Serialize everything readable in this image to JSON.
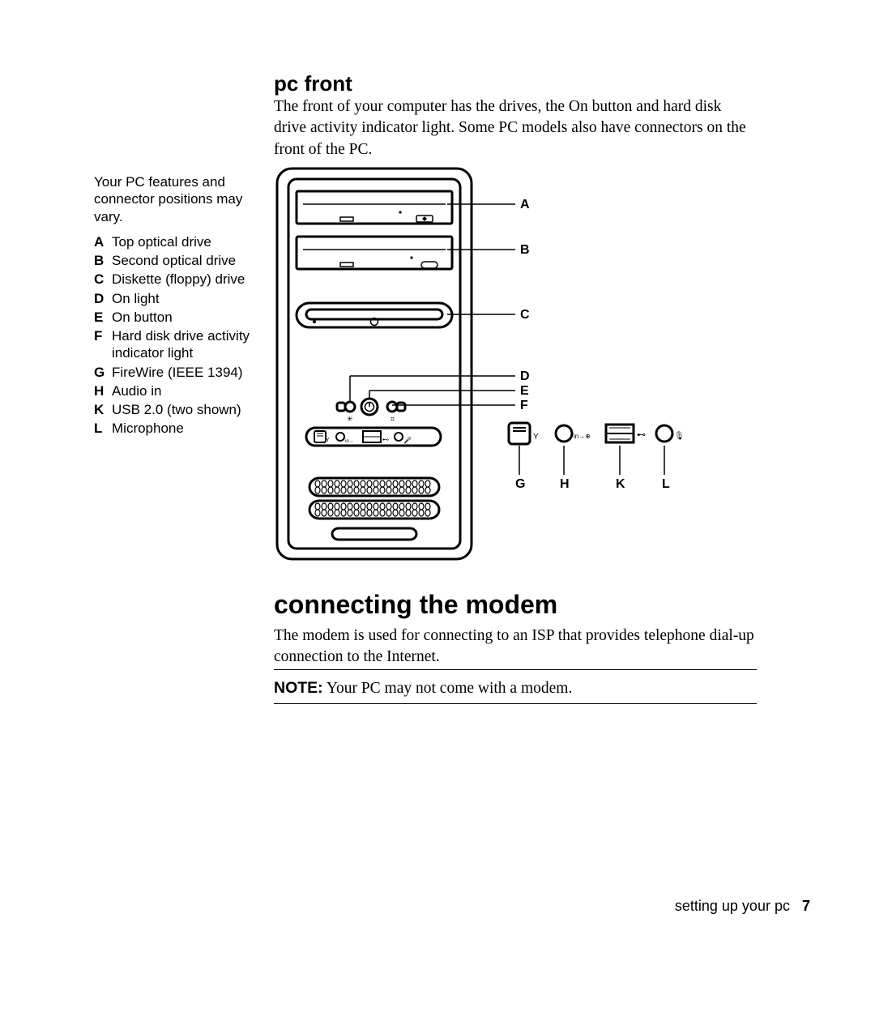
{
  "section1": {
    "title": "pc front",
    "body": "The front of your computer has the drives, the On button and hard disk drive activity indicator light. Some PC models also have connectors on the front of the PC."
  },
  "sidebar": {
    "intro": "Your PC features and connector positions may vary.",
    "items": [
      {
        "letter": "A",
        "text": "Top optical drive"
      },
      {
        "letter": "B",
        "text": "Second optical drive"
      },
      {
        "letter": "C",
        "text": "Diskette (floppy) drive"
      },
      {
        "letter": "D",
        "text": "On light"
      },
      {
        "letter": "E",
        "text": "On button"
      },
      {
        "letter": "F",
        "text": "Hard disk drive activity indicator light"
      },
      {
        "letter": "G",
        "text": "FireWire (IEEE 1394)"
      },
      {
        "letter": "H",
        "text": "Audio in"
      },
      {
        "letter": "K",
        "text": "USB 2.0 (two shown)"
      },
      {
        "letter": "L",
        "text": "Microphone"
      }
    ]
  },
  "diagram_callouts": {
    "A": "A",
    "B": "B",
    "C": "C",
    "D": "D",
    "E": "E",
    "F": "F",
    "G": "G",
    "H": "H",
    "K": "K",
    "L": "L"
  },
  "section2": {
    "title": "connecting the modem",
    "body": "The modem is used for connecting to an ISP that provides telephone dial-up connection to the Internet.",
    "note_label": "NOTE:",
    "note_text": " Your PC may not come with a modem."
  },
  "footer": {
    "text": "setting up your pc",
    "page": "7"
  }
}
